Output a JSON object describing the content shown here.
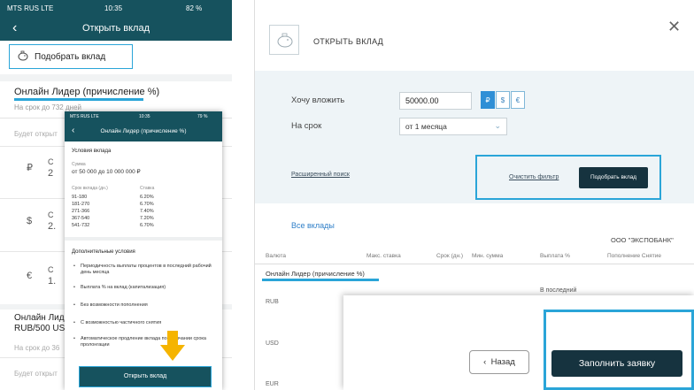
{
  "phone": {
    "status": {
      "carrier": "MTS RUS  LTE",
      "time": "10:35",
      "battery": "82 %"
    },
    "title": "Открыть вклад",
    "pick_label": "Подобрать вклад",
    "product": "Онлайн Лидер (причисление %)",
    "term": "На срок до 732 дней",
    "opened_label": "Будет открыт",
    "currencies": [
      {
        "symbol": "₽",
        "c1": "С",
        "c2": "2"
      },
      {
        "symbol": "$",
        "c1": "С",
        "c2": "2."
      },
      {
        "symbol": "€",
        "c1": "С",
        "c2": "1."
      }
    ],
    "product2_line1": "Онлайн Лиде",
    "product2_line2": "RUB/500 USD",
    "term2": "На срок до 36",
    "opened2_label": "Будет открыт"
  },
  "overlay": {
    "status": {
      "carrier": "MTS RUS  LTE",
      "time": "10:35",
      "battery": "79 %"
    },
    "title": "Онлайн Лидер (причисление %)",
    "conditions_title": "Условия вклада",
    "sum_label": "Сумма",
    "sum_value": "от 50 000 до 10 000 000 ₽",
    "col_term": "Срок вклада (дн.)",
    "col_rate": "Ставка",
    "rows": [
      {
        "term": "91-180",
        "rate": "6.20%"
      },
      {
        "term": "181-270",
        "rate": "6.70%"
      },
      {
        "term": "271-366",
        "rate": "7.40%"
      },
      {
        "term": "367-540",
        "rate": "7.20%"
      },
      {
        "term": "541-732",
        "rate": "6.70%"
      }
    ],
    "extra_title": "Дополнительные условия",
    "bullets": [
      "Периодичность выплаты процентов в последний рабочий день месяца",
      "Выплата % на вклад (капитализация)",
      "Без возможности пополнения",
      "С возможностью частичного снятия",
      "Автоматическое продление вклада по окончании срока пролонгации"
    ],
    "open_label": "Открыть вклад"
  },
  "web": {
    "title": "ОТКРЫТЬ ВКЛАД",
    "invest_label": "Хочу вложить",
    "invest_value": "50000.00",
    "currencies": [
      "₽",
      "$",
      "€"
    ],
    "selected_currency": "₽",
    "term_label": "На срок",
    "term_value": "от 1 месяца",
    "advanced_search": "Расширенный поиск",
    "clear_filter": "Очистить фильтр",
    "pick_deposit": "Подобрать вклад",
    "all_deposits": "Все вклады",
    "bank": "ООО \"ЭКСПОБАНК\"",
    "columns": [
      "Валюта",
      "Макс. ставка",
      "Срок (дн.)",
      "Мин. сумма",
      "Выплата %",
      "Пополнение Снятие"
    ],
    "product": "Онлайн Лидер (причисление %)",
    "payout_value": "В последний",
    "rows": [
      "RUB",
      "USD",
      "EUR"
    ],
    "back_label": "Назад",
    "apply_label": "Заполнить заявку"
  },
  "colors": {
    "accent": "#2aa5d8",
    "header": "#16525e",
    "dark_button": "#16333f",
    "form_bg": "#eef4f7"
  }
}
